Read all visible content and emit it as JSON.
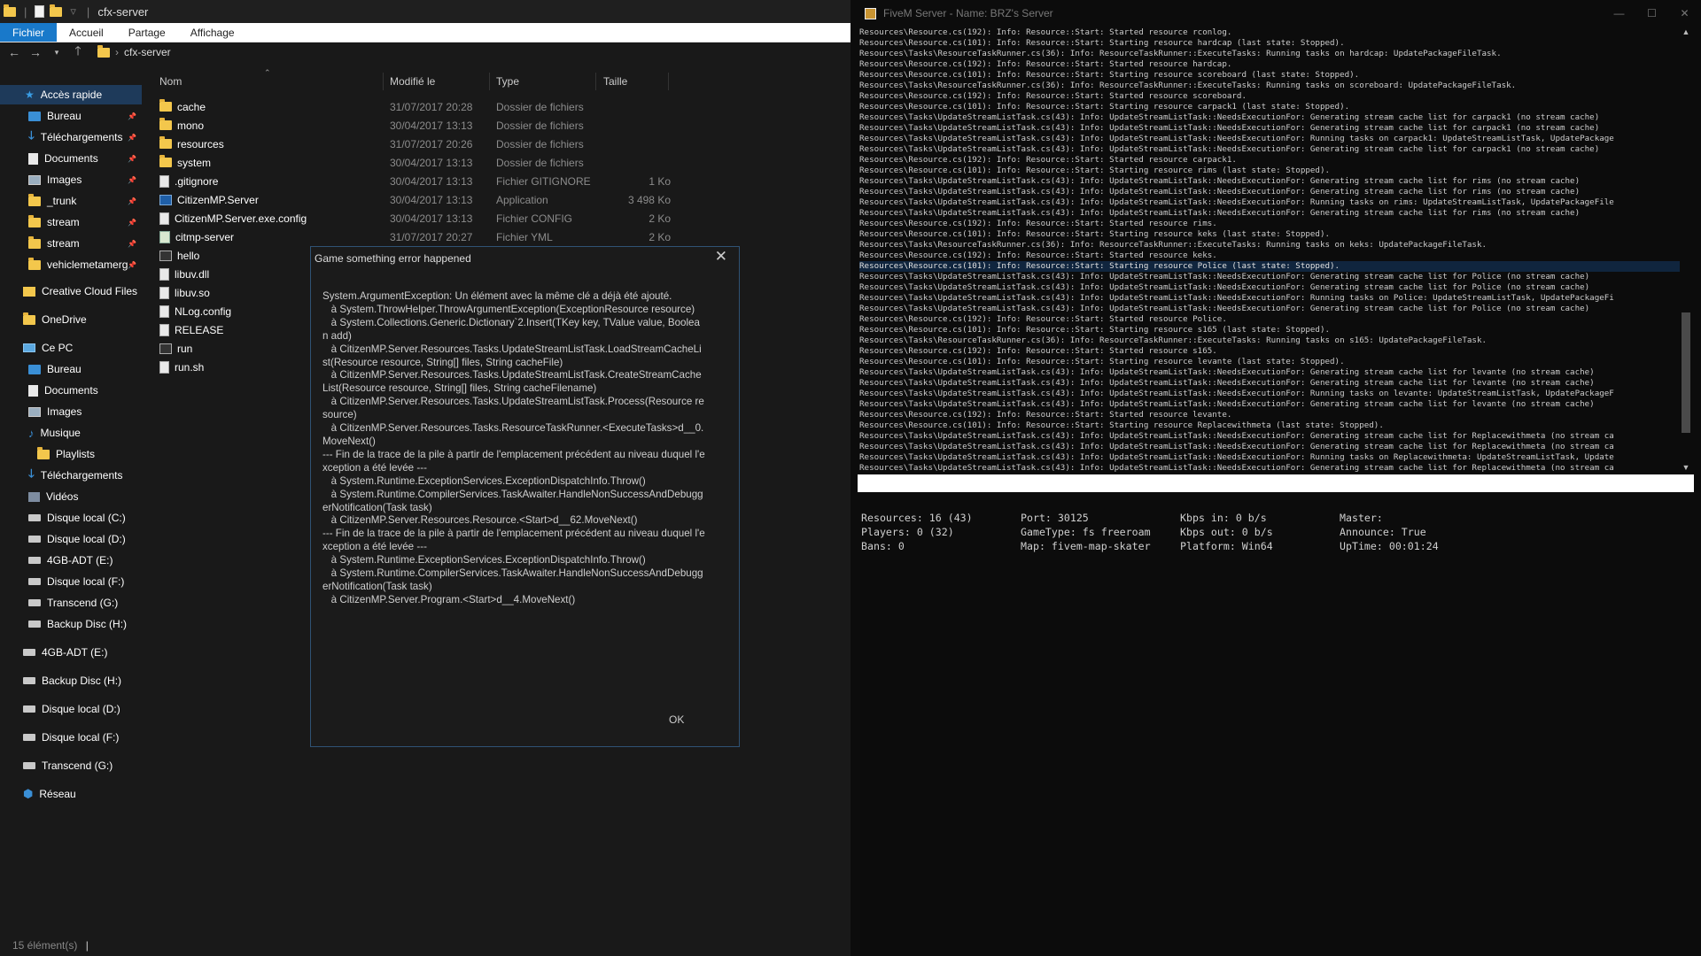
{
  "explorer": {
    "title": "cfx-server",
    "ribbon_tabs": [
      "Fichier",
      "Accueil",
      "Partage",
      "Affichage"
    ],
    "path": "cfx-server",
    "columns": {
      "name": "Nom",
      "modified": "Modifié le",
      "type": "Type",
      "size": "Taille"
    },
    "nav": [
      {
        "label": "Accès rapide",
        "icon": "star-icon",
        "pinned": false
      },
      {
        "label": "Bureau",
        "icon": "desktop-icon",
        "pinned": true
      },
      {
        "label": "Téléchargements",
        "icon": "download-icon",
        "pinned": true
      },
      {
        "label": "Documents",
        "icon": "documents-icon",
        "pinned": true
      },
      {
        "label": "Images",
        "icon": "images-icon",
        "pinned": true
      },
      {
        "label": "_trunk",
        "icon": "folder-icon",
        "pinned": true
      },
      {
        "label": "stream",
        "icon": "folder-icon",
        "pinned": true
      },
      {
        "label": "stream",
        "icon": "folder-icon",
        "pinned": true
      },
      {
        "label": "vehiclemetamerg",
        "icon": "folder-icon",
        "pinned": true
      },
      {
        "label": "Creative Cloud Files",
        "icon": "cloud-icon",
        "pinned": false
      },
      {
        "label": "OneDrive",
        "icon": "onedrive-icon",
        "pinned": false
      },
      {
        "label": "Ce PC",
        "icon": "pc-icon",
        "pinned": false
      },
      {
        "label": "Bureau",
        "icon": "desktop-icon",
        "pinned": false
      },
      {
        "label": "Documents",
        "icon": "documents-icon",
        "pinned": false
      },
      {
        "label": "Images",
        "icon": "images-icon",
        "pinned": false
      },
      {
        "label": "Musique",
        "icon": "music-icon",
        "pinned": false
      },
      {
        "label": "Playlists",
        "icon": "folder-icon",
        "pinned": false
      },
      {
        "label": "Téléchargements",
        "icon": "download-icon",
        "pinned": false
      },
      {
        "label": "Vidéos",
        "icon": "video-icon",
        "pinned": false
      },
      {
        "label": "Disque local (C:)",
        "icon": "drive-icon",
        "pinned": false
      },
      {
        "label": "Disque local (D:)",
        "icon": "drive-icon",
        "pinned": false
      },
      {
        "label": "4GB-ADT (E:)",
        "icon": "drive-icon",
        "pinned": false
      },
      {
        "label": "Disque local (F:)",
        "icon": "drive-icon",
        "pinned": false
      },
      {
        "label": "Transcend (G:)",
        "icon": "drive-icon",
        "pinned": false
      },
      {
        "label": "Backup Disc (H:)",
        "icon": "drive-icon",
        "pinned": false
      },
      {
        "label": "4GB-ADT (E:)",
        "icon": "drive-icon",
        "pinned": false
      },
      {
        "label": "Backup Disc (H:)",
        "icon": "drive-icon",
        "pinned": false
      },
      {
        "label": "Disque local (D:)",
        "icon": "drive-icon",
        "pinned": false
      },
      {
        "label": "Disque local (F:)",
        "icon": "drive-icon",
        "pinned": false
      },
      {
        "label": "Transcend (G:)",
        "icon": "drive-icon",
        "pinned": false
      },
      {
        "label": "Réseau",
        "icon": "network-icon",
        "pinned": false
      }
    ],
    "files": [
      {
        "name": "cache",
        "modified": "31/07/2017 20:28",
        "type": "Dossier de fichiers",
        "size": "",
        "icon": "folder-icon"
      },
      {
        "name": "mono",
        "modified": "30/04/2017 13:13",
        "type": "Dossier de fichiers",
        "size": "",
        "icon": "folder-icon"
      },
      {
        "name": "resources",
        "modified": "31/07/2017 20:26",
        "type": "Dossier de fichiers",
        "size": "",
        "icon": "folder-icon"
      },
      {
        "name": "system",
        "modified": "30/04/2017 13:13",
        "type": "Dossier de fichiers",
        "size": "",
        "icon": "folder-icon"
      },
      {
        "name": ".gitignore",
        "modified": "30/04/2017 13:13",
        "type": "Fichier GITIGNORE",
        "size": "1 Ko",
        "icon": "file-icon"
      },
      {
        "name": "CitizenMP.Server",
        "modified": "30/04/2017 13:13",
        "type": "Application",
        "size": "3 498 Ko",
        "icon": "app-icon"
      },
      {
        "name": "CitizenMP.Server.exe.config",
        "modified": "30/04/2017 13:13",
        "type": "Fichier CONFIG",
        "size": "2 Ko",
        "icon": "config-icon"
      },
      {
        "name": "citmp-server",
        "modified": "31/07/2017 20:27",
        "type": "Fichier YML",
        "size": "2 Ko",
        "icon": "yml-icon"
      },
      {
        "name": "hello",
        "modified": "",
        "type": "",
        "size": "",
        "icon": "shell-icon"
      },
      {
        "name": "libuv.dll",
        "modified": "",
        "type": "",
        "size": "",
        "icon": "file-icon"
      },
      {
        "name": "libuv.so",
        "modified": "",
        "type": "",
        "size": "",
        "icon": "file-icon"
      },
      {
        "name": "NLog.config",
        "modified": "",
        "type": "",
        "size": "",
        "icon": "file-icon"
      },
      {
        "name": "RELEASE",
        "modified": "",
        "type": "",
        "size": "",
        "icon": "file-icon"
      },
      {
        "name": "run",
        "modified": "",
        "type": "",
        "size": "",
        "icon": "shell-icon"
      },
      {
        "name": "run.sh",
        "modified": "",
        "type": "",
        "size": "",
        "icon": "file-icon"
      }
    ],
    "status": "15 élément(s)"
  },
  "dialog": {
    "title": "Game something error happened",
    "message": "System.ArgumentException: Un élément avec la même clé a déjà été ajouté.\n   à System.ThrowHelper.ThrowArgumentException(ExceptionResource resource)\n   à System.Collections.Generic.Dictionary`2.Insert(TKey key, TValue value, Boolean add)\n   à CitizenMP.Server.Resources.Tasks.UpdateStreamListTask.LoadStreamCacheList(Resource resource, String[] files, String cacheFile)\n   à CitizenMP.Server.Resources.Tasks.UpdateStreamListTask.CreateStreamCacheList(Resource resource, String[] files, String cacheFilename)\n   à CitizenMP.Server.Resources.Tasks.UpdateStreamListTask.Process(Resource resource)\n   à CitizenMP.Server.Resources.Tasks.ResourceTaskRunner.<ExecuteTasks>d__0.MoveNext()\n--- Fin de la trace de la pile à partir de l'emplacement précédent au niveau duquel l'exception a été levée ---\n   à System.Runtime.ExceptionServices.ExceptionDispatchInfo.Throw()\n   à System.Runtime.CompilerServices.TaskAwaiter.HandleNonSuccessAndDebuggerNotification(Task task)\n   à CitizenMP.Server.Resources.Resource.<Start>d__62.MoveNext()\n--- Fin de la trace de la pile à partir de l'emplacement précédent au niveau duquel l'exception a été levée ---\n   à System.Runtime.ExceptionServices.ExceptionDispatchInfo.Throw()\n   à System.Runtime.CompilerServices.TaskAwaiter.HandleNonSuccessAndDebuggerNotification(Task task)\n   à CitizenMP.Server.Program.<Start>d__4.MoveNext()",
    "ok_label": "OK"
  },
  "console": {
    "title": "FiveM Server - Name: BRZ's Server",
    "log": [
      "Resources\\Resource.cs(192): Info: Resource::Start: Started resource rconlog.",
      "Resources\\Resource.cs(101): Info: Resource::Start: Starting resource hardcap (last state: Stopped).",
      "Resources\\Tasks\\ResourceTaskRunner.cs(36): Info: ResourceTaskRunner::ExecuteTasks: Running tasks on hardcap: UpdatePackageFileTask.",
      "Resources\\Resource.cs(192): Info: Resource::Start: Started resource hardcap.",
      "Resources\\Resource.cs(101): Info: Resource::Start: Starting resource scoreboard (last state: Stopped).",
      "Resources\\Tasks\\ResourceTaskRunner.cs(36): Info: ResourceTaskRunner::ExecuteTasks: Running tasks on scoreboard: UpdatePackageFileTask.",
      "Resources\\Resource.cs(192): Info: Resource::Start: Started resource scoreboard.",
      "Resources\\Resource.cs(101): Info: Resource::Start: Starting resource carpack1 (last state: Stopped).",
      "Resources\\Tasks\\UpdateStreamListTask.cs(43): Info: UpdateStreamListTask::NeedsExecutionFor: Generating stream cache list for carpack1 (no stream cache)",
      "Resources\\Tasks\\UpdateStreamListTask.cs(43): Info: UpdateStreamListTask::NeedsExecutionFor: Generating stream cache list for carpack1 (no stream cache)",
      "Resources\\Tasks\\UpdateStreamListTask.cs(43): Info: UpdateStreamListTask::NeedsExecutionFor: Running tasks on carpack1: UpdateStreamListTask, UpdatePackage",
      "Resources\\Tasks\\UpdateStreamListTask.cs(43): Info: UpdateStreamListTask::NeedsExecutionFor: Generating stream cache list for carpack1 (no stream cache)",
      "Resources\\Resource.cs(192): Info: Resource::Start: Started resource carpack1.",
      "Resources\\Resource.cs(101): Info: Resource::Start: Starting resource rims (last state: Stopped).",
      "Resources\\Tasks\\UpdateStreamListTask.cs(43): Info: UpdateStreamListTask::NeedsExecutionFor: Generating stream cache list for rims (no stream cache)",
      "Resources\\Tasks\\UpdateStreamListTask.cs(43): Info: UpdateStreamListTask::NeedsExecutionFor: Generating stream cache list for rims (no stream cache)",
      "Resources\\Tasks\\UpdateStreamListTask.cs(43): Info: UpdateStreamListTask::NeedsExecutionFor: Running tasks on rims: UpdateStreamListTask, UpdatePackageFile",
      "Resources\\Tasks\\UpdateStreamListTask.cs(43): Info: UpdateStreamListTask::NeedsExecutionFor: Generating stream cache list for rims (no stream cache)",
      "Resources\\Resource.cs(192): Info: Resource::Start: Started resource rims.",
      "Resources\\Resource.cs(101): Info: Resource::Start: Starting resource keks (last state: Stopped).",
      "Resources\\Tasks\\ResourceTaskRunner.cs(36): Info: ResourceTaskRunner::ExecuteTasks: Running tasks on keks: UpdatePackageFileTask.",
      "Resources\\Resource.cs(192): Info: Resource::Start: Started resource keks.",
      "Resources\\Resource.cs(101): Info: Resource::Start: Starting resource Police (last state: Stopped).",
      "Resources\\Tasks\\UpdateStreamListTask.cs(43): Info: UpdateStreamListTask::NeedsExecutionFor: Generating stream cache list for Police (no stream cache)",
      "Resources\\Tasks\\UpdateStreamListTask.cs(43): Info: UpdateStreamListTask::NeedsExecutionFor: Generating stream cache list for Police (no stream cache)",
      "Resources\\Tasks\\UpdateStreamListTask.cs(43): Info: UpdateStreamListTask::NeedsExecutionFor: Running tasks on Police: UpdateStreamListTask, UpdatePackageFi",
      "Resources\\Tasks\\UpdateStreamListTask.cs(43): Info: UpdateStreamListTask::NeedsExecutionFor: Generating stream cache list for Police (no stream cache)",
      "Resources\\Resource.cs(192): Info: Resource::Start: Started resource Police.",
      "Resources\\Resource.cs(101): Info: Resource::Start: Starting resource s165 (last state: Stopped).",
      "Resources\\Tasks\\ResourceTaskRunner.cs(36): Info: ResourceTaskRunner::ExecuteTasks: Running tasks on s165: UpdatePackageFileTask.",
      "Resources\\Resource.cs(192): Info: Resource::Start: Started resource s165.",
      "Resources\\Resource.cs(101): Info: Resource::Start: Starting resource levante (last state: Stopped).",
      "Resources\\Tasks\\UpdateStreamListTask.cs(43): Info: UpdateStreamListTask::NeedsExecutionFor: Generating stream cache list for levante (no stream cache)",
      "Resources\\Tasks\\UpdateStreamListTask.cs(43): Info: UpdateStreamListTask::NeedsExecutionFor: Generating stream cache list for levante (no stream cache)",
      "Resources\\Tasks\\UpdateStreamListTask.cs(43): Info: UpdateStreamListTask::NeedsExecutionFor: Running tasks on levante: UpdateStreamListTask, UpdatePackageF",
      "Resources\\Tasks\\UpdateStreamListTask.cs(43): Info: UpdateStreamListTask::NeedsExecutionFor: Generating stream cache list for levante (no stream cache)",
      "Resources\\Resource.cs(192): Info: Resource::Start: Started resource levante.",
      "Resources\\Resource.cs(101): Info: Resource::Start: Starting resource Replacewithmeta (last state: Stopped).",
      "Resources\\Tasks\\UpdateStreamListTask.cs(43): Info: UpdateStreamListTask::NeedsExecutionFor: Generating stream cache list for Replacewithmeta (no stream ca",
      "Resources\\Tasks\\UpdateStreamListTask.cs(43): Info: UpdateStreamListTask::NeedsExecutionFor: Generating stream cache list for Replacewithmeta (no stream ca",
      "Resources\\Tasks\\UpdateStreamListTask.cs(43): Info: UpdateStreamListTask::NeedsExecutionFor: Running tasks on Replacewithmeta: UpdateStreamListTask, Update",
      "Resources\\Tasks\\UpdateStreamListTask.cs(43): Info: UpdateStreamListTask::NeedsExecutionFor: Generating stream cache list for Replacewithmeta (no stream ca"
    ],
    "highlighted_line": 22,
    "input_value": "",
    "stats": {
      "resources": "Resources: 16 (43)",
      "players": "Players: 0 (32)",
      "bans": "Bans: 0",
      "port": "Port: 30125",
      "gametype": "GameType: fs freeroam",
      "map": "Map: fivem-map-skater",
      "kbps_in": "Kbps in: 0 b/s",
      "kbps_out": "Kbps out: 0 b/s",
      "platform": "Platform: Win64",
      "master": "Master:",
      "announce": "Announce: True",
      "uptime": "UpTime: 00:01:24"
    }
  }
}
